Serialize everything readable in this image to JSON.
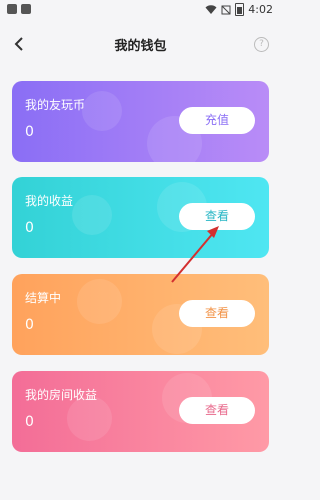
{
  "status": {
    "time": "4:02"
  },
  "nav": {
    "title": "我的钱包",
    "help": "?"
  },
  "cards": [
    {
      "label": "我的友玩币",
      "value": "0",
      "button": "充值"
    },
    {
      "label": "我的收益",
      "value": "0",
      "button": "查看"
    },
    {
      "label": "结算中",
      "value": "0",
      "button": "查看"
    },
    {
      "label": "我的房间收益",
      "value": "0",
      "button": "查看"
    }
  ],
  "colors": {
    "arrow": "#d32f2f"
  },
  "icons": [
    "wifi-icon",
    "sim-icon",
    "battery-icon",
    "back-icon",
    "help-icon"
  ]
}
